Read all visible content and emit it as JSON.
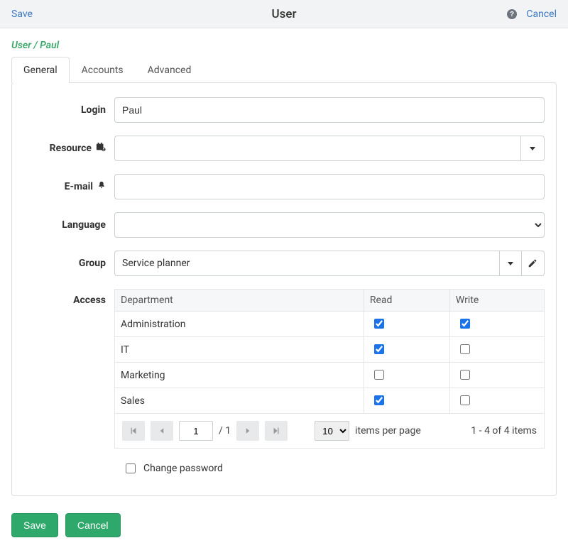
{
  "header": {
    "save_label": "Save",
    "title": "User",
    "cancel_label": "Cancel"
  },
  "breadcrumb": "User / Paul",
  "tabs": [
    "General",
    "Accounts",
    "Advanced"
  ],
  "form": {
    "login_label": "Login",
    "login_value": "Paul",
    "resource_label": "Resource",
    "resource_value": "",
    "email_label": "E-mail",
    "email_value": "",
    "language_label": "Language",
    "language_value": "",
    "group_label": "Group",
    "group_value": "Service planner",
    "access_label": "Access",
    "change_password_label": "Change password"
  },
  "access": {
    "cols": {
      "dept": "Department",
      "read": "Read",
      "write": "Write"
    },
    "rows": [
      {
        "dept": "Administration",
        "read": true,
        "write": true
      },
      {
        "dept": "IT",
        "read": true,
        "write": false
      },
      {
        "dept": "Marketing",
        "read": false,
        "write": false
      },
      {
        "dept": "Sales",
        "read": true,
        "write": false
      }
    ],
    "pager": {
      "page": "1",
      "total_pages": "1",
      "per_page": "10",
      "per_page_label": "items per page",
      "range": "1 - 4 of 4 items"
    }
  },
  "footer": {
    "save_label": "Save",
    "cancel_label": "Cancel"
  }
}
